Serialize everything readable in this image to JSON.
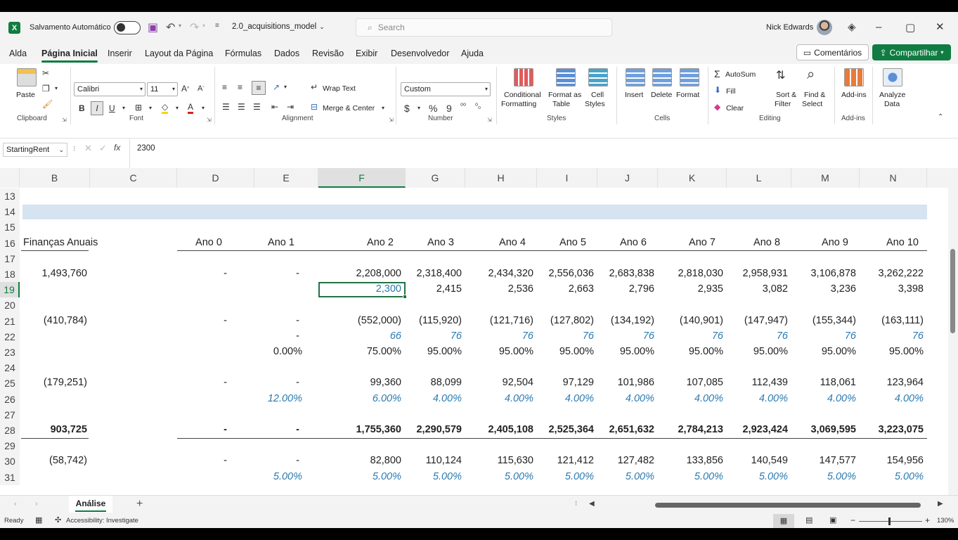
{
  "titlebar": {
    "autosave_label": "Salvamento Automático",
    "filename": "2.0_acquisitions_model",
    "search_placeholder": "Search",
    "user_name": "Nick Edwards"
  },
  "menu": {
    "tabs": [
      "Alda",
      "Página Inicial",
      "Inserir",
      "Layout da Página",
      "Fórmulas",
      "Dados",
      "Revisão",
      "Exibir",
      "Desenvolvedor",
      "Ajuda"
    ],
    "active_tab": "Página Inicial",
    "comments_label": "Comentários",
    "share_label": "Compartilhar"
  },
  "ribbon": {
    "clipboard": {
      "paste": "Paste",
      "label": "Clipboard"
    },
    "font": {
      "name": "Calibri",
      "size": "11",
      "label": "Font"
    },
    "alignment": {
      "wrap": "Wrap Text",
      "merge": "Merge & Center",
      "label": "Alignment"
    },
    "number": {
      "format": "Custom",
      "label": "Number"
    },
    "styles": {
      "cond1": "Conditional",
      "cond2": "Formatting",
      "fmt1": "Format as",
      "fmt2": "Table",
      "cell1": "Cell",
      "cell2": "Styles",
      "label": "Styles"
    },
    "cells": {
      "insert": "Insert",
      "delete": "Delete",
      "format": "Format",
      "label": "Cells"
    },
    "editing": {
      "autosum": "AutoSum",
      "fill": "Fill",
      "clear": "Clear",
      "sort1": "Sort &",
      "sort2": "Filter",
      "find1": "Find &",
      "find2": "Select",
      "label": "Editing"
    },
    "addins": {
      "addins": "Add-ins",
      "label": "Add-ins",
      "analyze1": "Analyze",
      "analyze2": "Data"
    }
  },
  "formula_bar": {
    "name_box": "StartingRent",
    "value": "2300"
  },
  "grid": {
    "columns": [
      "B",
      "C",
      "D",
      "E",
      "F",
      "G",
      "H",
      "I",
      "J",
      "K",
      "L",
      "M",
      "N"
    ],
    "selected_column": "F",
    "selected_row": "19",
    "rows": [
      {
        "num": "13"
      },
      {
        "num": "14"
      },
      {
        "num": "15"
      },
      {
        "num": "16",
        "label": "Finanças Anuais",
        "style": "header",
        "values": [
          "Ano 0",
          "Ano 1",
          "Ano 2",
          "Ano 3",
          "Ano 4",
          "Ano 5",
          "Ano 6",
          "Ano 7",
          "Ano 8",
          "Ano 9",
          "Ano 10"
        ]
      },
      {
        "num": "17"
      },
      {
        "num": "18",
        "b": "1,493,760",
        "values": [
          "-",
          "-",
          "2,208,000",
          "2,318,400",
          "2,434,320",
          "2,556,036",
          "2,683,838",
          "2,818,030",
          "2,958,931",
          "3,106,878",
          "3,262,222"
        ]
      },
      {
        "num": "19",
        "values": [
          "",
          "",
          "2,300",
          "2,415",
          "2,536",
          "2,663",
          "2,796",
          "2,935",
          "3,082",
          "3,236",
          "3,398"
        ]
      },
      {
        "num": "20"
      },
      {
        "num": "21",
        "b": "(410,784)",
        "values": [
          "-",
          "-",
          "(552,000)",
          "(115,920)",
          "(121,716)",
          "(127,802)",
          "(134,192)",
          "(140,901)",
          "(147,947)",
          "(155,344)",
          "(163,111)"
        ]
      },
      {
        "num": "22",
        "style": "blue",
        "values": [
          "",
          "-",
          "66",
          "76",
          "76",
          "76",
          "76",
          "76",
          "76",
          "76",
          "76"
        ]
      },
      {
        "num": "23",
        "values": [
          "",
          "0.00%",
          "75.00%",
          "95.00%",
          "95.00%",
          "95.00%",
          "95.00%",
          "95.00%",
          "95.00%",
          "95.00%",
          "95.00%"
        ]
      },
      {
        "num": "24"
      },
      {
        "num": "25",
        "b": "(179,251)",
        "values": [
          "-",
          "-",
          "99,360",
          "88,099",
          "92,504",
          "97,129",
          "101,986",
          "107,085",
          "112,439",
          "118,061",
          "123,964"
        ]
      },
      {
        "num": "26",
        "style": "blue",
        "values": [
          "",
          "12.00%",
          "6.00%",
          "4.00%",
          "4.00%",
          "4.00%",
          "4.00%",
          "4.00%",
          "4.00%",
          "4.00%",
          "4.00%"
        ]
      },
      {
        "num": "27"
      },
      {
        "num": "28",
        "style": "bold",
        "b": "903,725",
        "values": [
          "-",
          "-",
          "1,755,360",
          "2,290,579",
          "2,405,108",
          "2,525,364",
          "2,651,632",
          "2,784,213",
          "2,923,424",
          "3,069,595",
          "3,223,075"
        ]
      },
      {
        "num": "29"
      },
      {
        "num": "30",
        "b": "(58,742)",
        "values": [
          "-",
          "-",
          "82,800",
          "110,124",
          "115,630",
          "121,412",
          "127,482",
          "133,856",
          "140,549",
          "147,577",
          "154,956"
        ]
      },
      {
        "num": "31",
        "style": "blue",
        "values": [
          "",
          "5.00%",
          "5.00%",
          "5.00%",
          "5.00%",
          "5.00%",
          "5.00%",
          "5.00%",
          "5.00%",
          "5.00%",
          "5.00%"
        ]
      }
    ]
  },
  "sheets": {
    "active": "Análise"
  },
  "status": {
    "ready": "Ready",
    "accessibility": "Accessibility: Investigate",
    "zoom": "130%"
  },
  "colors": {
    "accent": "#107c41",
    "blue_text": "#2a7ab0",
    "band": "#d6e3f0"
  }
}
